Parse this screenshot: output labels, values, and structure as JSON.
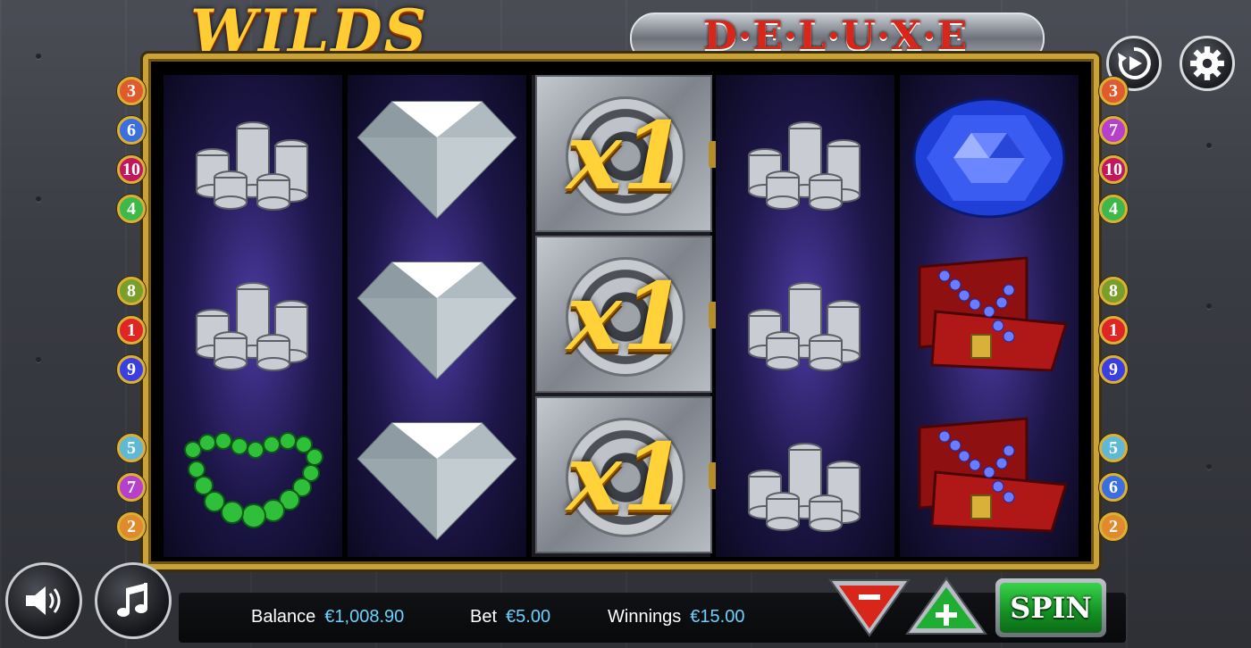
{
  "title": {
    "main": "WILDS",
    "sub": "D·E·L·U·X·E"
  },
  "top_buttons": {
    "autoplay_icon": "autoplay-icon",
    "settings_icon": "gear-icon"
  },
  "paylines_left": [
    "3",
    "6",
    "10",
    "4",
    "8",
    "1",
    "9",
    "5",
    "7",
    "2"
  ],
  "paylines_right": [
    "3",
    "7",
    "10",
    "4",
    "8",
    "1",
    "9",
    "5",
    "6",
    "2"
  ],
  "reels": [
    [
      "silver-coins",
      "silver-coins",
      "green-pearl-necklace"
    ],
    [
      "diamond",
      "diamond",
      "diamond"
    ],
    [
      "vault-wild",
      "vault-wild",
      "vault-wild"
    ],
    [
      "silver-coins",
      "silver-coins",
      "silver-coins"
    ],
    [
      "blue-sapphire",
      "treasure-chest",
      "treasure-chest"
    ]
  ],
  "wild_multiplier": "x1",
  "footer": {
    "balance_label": "Balance",
    "balance_value": "€1,008.90",
    "bet_label": "Bet",
    "bet_value": "€5.00",
    "winnings_label": "Winnings",
    "winnings_value": "€15.00",
    "spin_label": "SPIN",
    "decrease_icon": "minus-icon",
    "increase_icon": "plus-icon",
    "sound_icon": "speaker-icon",
    "music_icon": "music-note-icon"
  },
  "colors": {
    "accent_gold": "#c9a23a",
    "value_blue": "#6ad3ff",
    "spin_green": "#1fae33",
    "minus_red": "#d8261b"
  }
}
